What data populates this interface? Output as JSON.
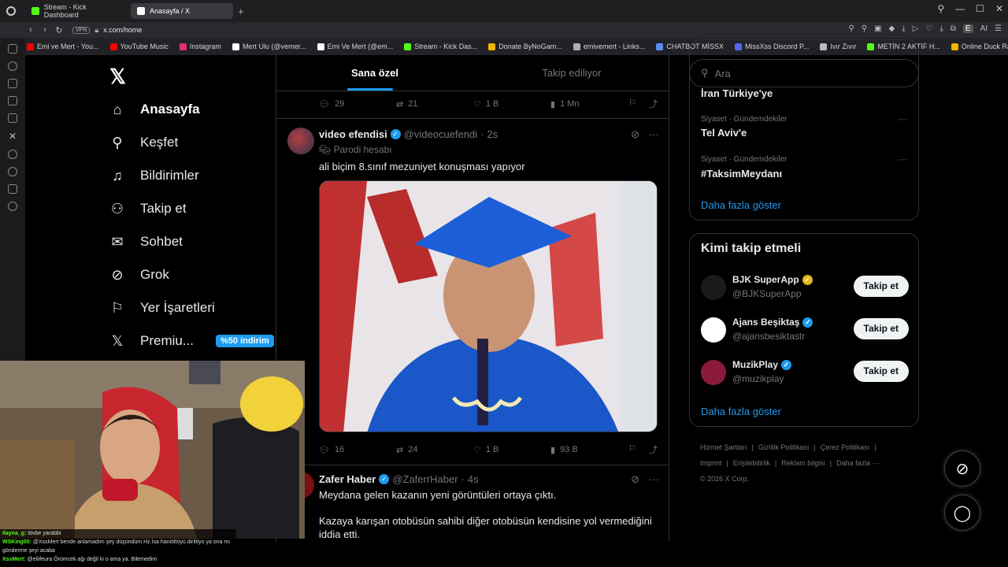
{
  "browser": {
    "tabs": [
      {
        "label": "Stream - Kick Dashboard",
        "active": false,
        "color": "#53fc18"
      },
      {
        "label": "Anasayfa / X",
        "active": true,
        "color": "#ffffff"
      }
    ],
    "vpn_label": "VPN",
    "url": "x.com/home",
    "ai_label": "AI",
    "profile_initial": "E",
    "bookmarks": [
      {
        "label": "Emi ve Mert - You...",
        "color": "#ff0000"
      },
      {
        "label": "YouTube Music",
        "color": "#ff0000"
      },
      {
        "label": "Instagram",
        "color": "#e1306c"
      },
      {
        "label": "Mert Ulu (@vemer...",
        "color": "#ffffff"
      },
      {
        "label": "Emi Ve Mert (@em...",
        "color": "#ffffff"
      },
      {
        "label": "Stream - Kick Das...",
        "color": "#53fc18"
      },
      {
        "label": "Donate ByNoGam...",
        "color": "#f4b400"
      },
      {
        "label": "emivemert - Links...",
        "color": "#b0b0b0"
      },
      {
        "label": "CHATBOT MİSSX",
        "color": "#5b8def"
      },
      {
        "label": "MissXss Discord P...",
        "color": "#5865f2"
      },
      {
        "label": "Ivır Zıvır",
        "color": "#bbbbbb"
      },
      {
        "label": "METİN 2 AKTİF H...",
        "color": "#53fc18"
      },
      {
        "label": "Online Duck Race...",
        "color": "#f4b400"
      }
    ]
  },
  "nav": {
    "items": [
      {
        "key": "home",
        "label": "Anasayfa",
        "icon": "home-icon",
        "glyph": "⌂",
        "active": true
      },
      {
        "key": "explore",
        "label": "Keşfet",
        "icon": "search-icon",
        "glyph": "⚲"
      },
      {
        "key": "notifications",
        "label": "Bildirimler",
        "icon": "bell-icon",
        "glyph": "♫"
      },
      {
        "key": "follow",
        "label": "Takip et",
        "icon": "add-person-icon",
        "glyph": "⚇"
      },
      {
        "key": "chat",
        "label": "Sohbet",
        "icon": "mail-icon",
        "glyph": "✉"
      },
      {
        "key": "grok",
        "label": "Grok",
        "icon": "grok-icon",
        "glyph": "⊘"
      },
      {
        "key": "bookmarks",
        "label": "Yer İşaretleri",
        "icon": "bookmark-icon",
        "glyph": "⚐"
      },
      {
        "key": "premium",
        "label": "Premiu...",
        "icon": "x-premium-icon",
        "glyph": "𝕏"
      }
    ],
    "premium_badge": "%50 indirim"
  },
  "feed": {
    "tabs": [
      {
        "label": "Sana özel",
        "active": true
      },
      {
        "label": "Takip ediliyor",
        "active": false
      }
    ],
    "top_actions": {
      "replies": "29",
      "reposts": "21",
      "likes": "1 B",
      "views": "1 Mn"
    },
    "tweets": [
      {
        "name": "video efendisi",
        "handle": "@videocuefendi",
        "time": "2s",
        "parody": "Parodi hesabı",
        "text": "ali biçim 8.sınıf mezuniyet konuşması yapıyor",
        "replies": "16",
        "reposts": "24",
        "likes": "1 B",
        "views": "93 B"
      },
      {
        "name": "Zafer Haber",
        "handle": "@ZaferrHaber",
        "time": "4s",
        "text_1": "Meydana gelen kazanın yeni görüntüleri ortaya çıktı.",
        "text_2": "Kazaya karışan otobüsün sahibi diğer otobüsün kendisine yol vermediğini iddia etti."
      }
    ]
  },
  "sidebar_right": {
    "search_placeholder": "Ara",
    "trends": [
      {
        "category": "",
        "title": "İran Türkiye'ye"
      },
      {
        "category": "Siyaset · Gündemdekiler",
        "title": "Tel Aviv'e"
      },
      {
        "category": "Siyaset · Gündemdekiler",
        "title": "#TaksimMeydanı"
      }
    ],
    "trends_show_more": "Daha fazla göster",
    "who_to_follow_title": "Kimi takip etmeli",
    "who_to_follow": [
      {
        "name": "BJK SuperApp",
        "handle": "@BJKSuperApp",
        "badge": "gold",
        "button": "Takip et",
        "avatar_color": "#1a1a1a"
      },
      {
        "name": "Ajans Beşiktaş",
        "handle": "@ajansbesiktastr",
        "badge": "blue",
        "button": "Takip et",
        "avatar_color": "#ffffff"
      },
      {
        "name": "MuzikPlay",
        "handle": "@muzikplay",
        "badge": "blue",
        "button": "Takip et",
        "avatar_color": "#8b1a3a"
      }
    ],
    "who_show_more": "Daha fazla göster",
    "footer": {
      "links_1": [
        "Hizmet Şartları",
        "|",
        "Gizlilik Politikası",
        "|",
        "Çerez Politikası",
        "|"
      ],
      "links_2": [
        "Imprint",
        "|",
        "Erişilebilirlik",
        "|",
        "Reklam bilgisi",
        "|",
        "Daha fazla ···"
      ],
      "copyright": "© 2026 X Corp."
    }
  },
  "stream_chat": [
    {
      "user": "Ilayna_g:",
      "msg": "tövbe yarabbi"
    },
    {
      "user": "WSKing00:",
      "msg": "@XssMert bende anlamadım şey düşündüm Hz.İsa haniöltüyü diriltiyo ya ona mı gönderme şeyi acaba"
    },
    {
      "user": "XssMert:",
      "msg": "@eliifeura Örümcek ağı değil ki o ama ya. Bilemedim"
    }
  ]
}
